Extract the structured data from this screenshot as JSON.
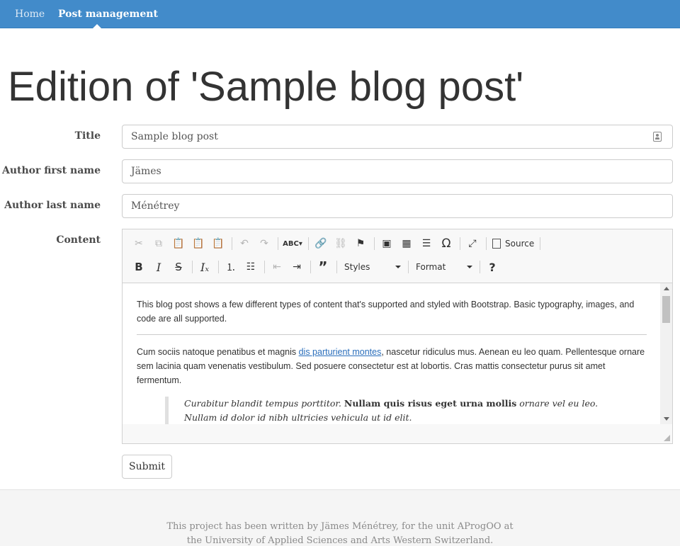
{
  "nav": {
    "home": "Home",
    "posts": "Post management"
  },
  "page": {
    "title": "Edition of 'Sample blog post'"
  },
  "form": {
    "title_label": "Title",
    "title_value": "Sample blog post",
    "first_name_label": "Author first name",
    "first_name_value": "Jämes",
    "last_name_label": "Author last name",
    "last_name_value": "Ménétrey",
    "content_label": "Content",
    "submit_label": "Submit"
  },
  "editor": {
    "toolbar": {
      "source_label": "Source",
      "styles_label": "Styles",
      "format_label": "Format",
      "icons_row1": [
        "cut-icon",
        "copy-icon",
        "paste-icon",
        "paste-text-icon",
        "paste-word-icon",
        "undo-icon",
        "redo-icon",
        "spellcheck-icon",
        "link-icon",
        "unlink-icon",
        "anchor-icon",
        "image-icon",
        "table-icon",
        "horizontal-line-icon",
        "special-char-icon",
        "maximize-icon",
        "source-icon"
      ],
      "icons_row2": [
        "bold-icon",
        "italic-icon",
        "strike-icon",
        "remove-format-icon",
        "numbered-list-icon",
        "bulleted-list-icon",
        "outdent-icon",
        "indent-icon",
        "blockquote-icon",
        "help-icon"
      ]
    },
    "content": {
      "p1": "This blog post shows a few different types of content that's supported and styled with Bootstrap. Basic typography, images, and code are all supported.",
      "p2_before": "Cum sociis natoque penatibus et magnis ",
      "p2_link": "dis parturient montes",
      "p2_after": ", nascetur ridiculus mus. Aenean eu leo quam. Pellentesque ornare sem lacinia quam venenatis vestibulum. Sed posuere consectetur est at lobortis. Cras mattis consectetur purus sit amet fermentum.",
      "quote_before": "Curabitur blandit tempus porttitor. ",
      "quote_bold": "Nullam quis risus eget urna mollis",
      "quote_after": " ornare vel eu leo. Nullam id dolor id nibh ultricies vehicula ut id elit."
    }
  },
  "footer": {
    "line1": "This project has been written by Jämes Ménétrey, for the unit AProgOO at",
    "line2": "the University of Applied Sciences and Arts Western Switzerland."
  }
}
